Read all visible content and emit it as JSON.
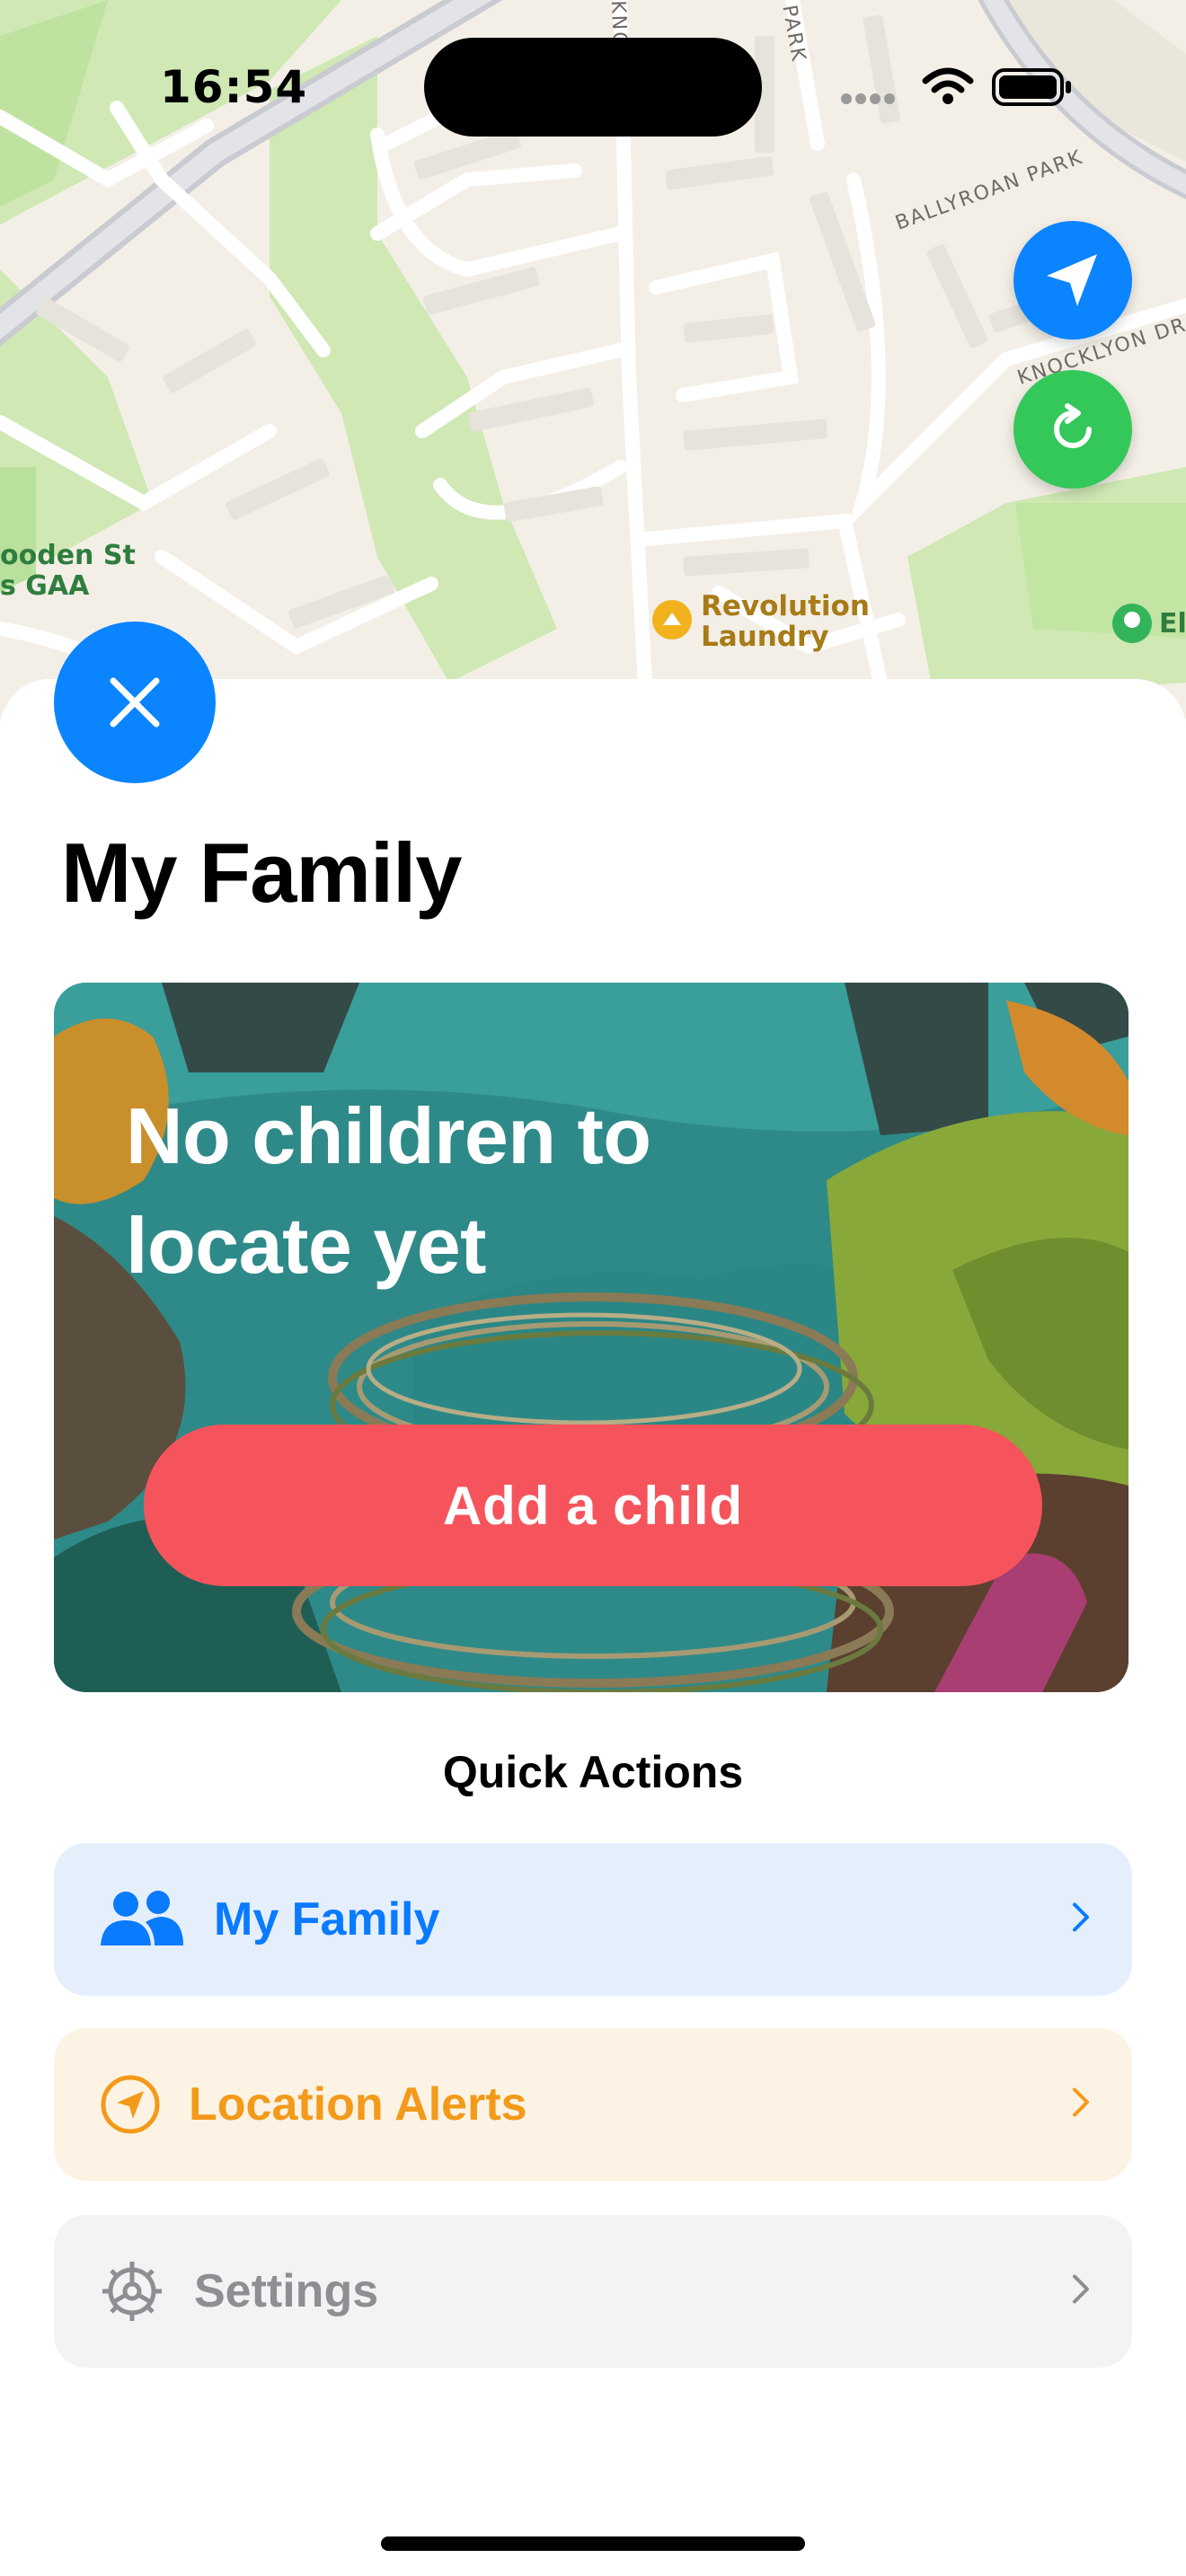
{
  "status_bar": {
    "time": "16:54"
  },
  "map": {
    "labels": {
      "ballyroan": "BALLYROAN PARK",
      "knocklyon": "KNOCKLYON DR",
      "park": "PARK",
      "knockly": "KNOCKLY",
      "gaa_line1": "ooden St",
      "gaa_line2": "s GAA",
      "poi_line1": "Revolution",
      "poi_line2": "Laundry",
      "edge_poi": "El"
    }
  },
  "sheet": {
    "title": "My Family",
    "hero": {
      "message": "No children to locate yet",
      "button": "Add a child"
    },
    "quick_actions": {
      "title": "Quick Actions",
      "items": [
        {
          "label": "My Family",
          "icon": "people-icon",
          "color": "#0a7aff"
        },
        {
          "label": "Location Alerts",
          "icon": "location-arrow-icon",
          "color": "#f39a1a"
        },
        {
          "label": "Settings",
          "icon": "gear-icon",
          "color": "#8e8e93"
        }
      ]
    }
  },
  "colors": {
    "primary_blue": "#0a84ff",
    "refresh_green": "#34c759",
    "add_child_red": "#f6545c"
  }
}
